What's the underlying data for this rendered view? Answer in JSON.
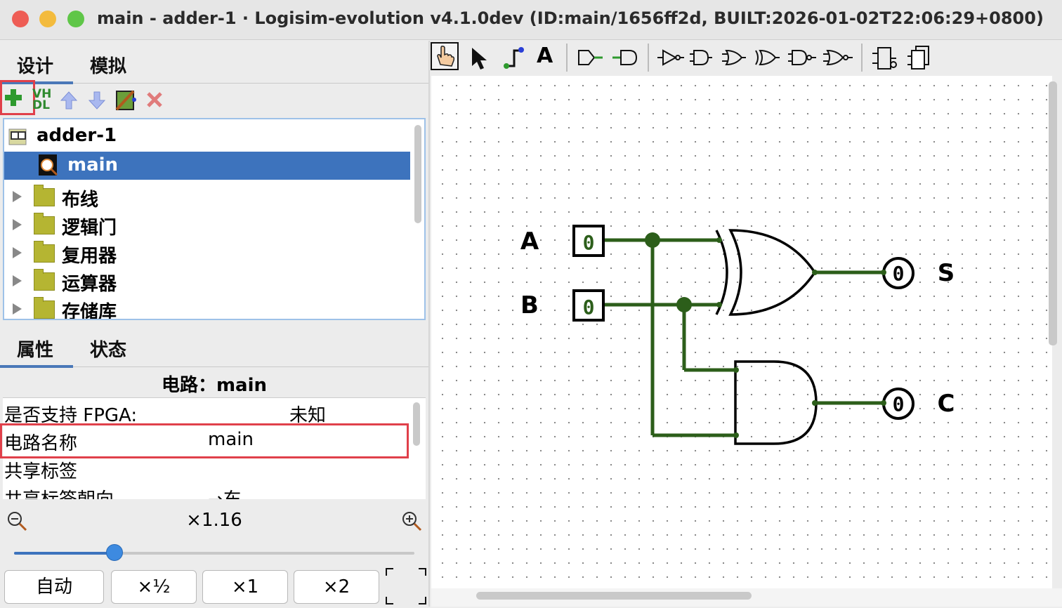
{
  "window": {
    "title": "main - adder-1 · Logisim-evolution v4.1.0dev (ID:main/1656ff2d, BUILT:2026-01-02T22:06:29+0800)"
  },
  "colors": {
    "wire": "#2c5e1a",
    "selection": "#3d73bd",
    "highlight_box": "#e0404a",
    "folder": "#b5b532"
  },
  "top_tabs": {
    "design": "设计",
    "simulate": "模拟",
    "active": "design"
  },
  "project_toolbar": {
    "icons": [
      "add-circuit-icon",
      "vhdl-icon",
      "move-up-icon",
      "move-down-icon",
      "edit-layout-icon",
      "delete-icon"
    ],
    "vhdl_label_top": "VH",
    "vhdl_label_bottom": "DL"
  },
  "tree": {
    "project": "adder-1",
    "selected_circuit": "main",
    "circuit_icon_label": "main",
    "libraries": [
      "布线",
      "逻辑门",
      "复用器",
      "运算器",
      "存储库"
    ]
  },
  "bottom_tabs": {
    "properties": "属性",
    "state": "状态",
    "active": "properties"
  },
  "properties": {
    "heading": "电路：main",
    "rows": [
      {
        "label": "是否支持 FPGA:",
        "value": "未知"
      },
      {
        "label": "电路名称",
        "value": "main"
      },
      {
        "label": "共享标签",
        "value": ""
      },
      {
        "label": "共享标签朝向",
        "value": "→东"
      }
    ]
  },
  "zoom": {
    "level": "×1.16",
    "slider_fraction": 0.25,
    "buttons": [
      "自动",
      "×½",
      "×1",
      "×2"
    ]
  },
  "canvas_toolbar": {
    "tools": [
      "poke-tool-icon",
      "select-tool-icon",
      "wiring-tool-icon",
      "text-tool-icon",
      "input-pin-icon",
      "output-pin-icon",
      "not-gate-icon",
      "and-gate-icon",
      "or-gate-icon",
      "xor-gate-icon",
      "nand-gate-icon",
      "nor-gate-icon",
      "add-circuit-icon",
      "add-vhdl-icon"
    ],
    "text_tool_label": "A",
    "active": "poke-tool-icon"
  },
  "circuit": {
    "inputs": [
      {
        "label": "A",
        "value": "0"
      },
      {
        "label": "B",
        "value": "0"
      }
    ],
    "outputs": [
      {
        "label": "S",
        "value": "0"
      },
      {
        "label": "C",
        "value": "0"
      }
    ],
    "gates": [
      "xor-gate",
      "and-gate"
    ]
  }
}
